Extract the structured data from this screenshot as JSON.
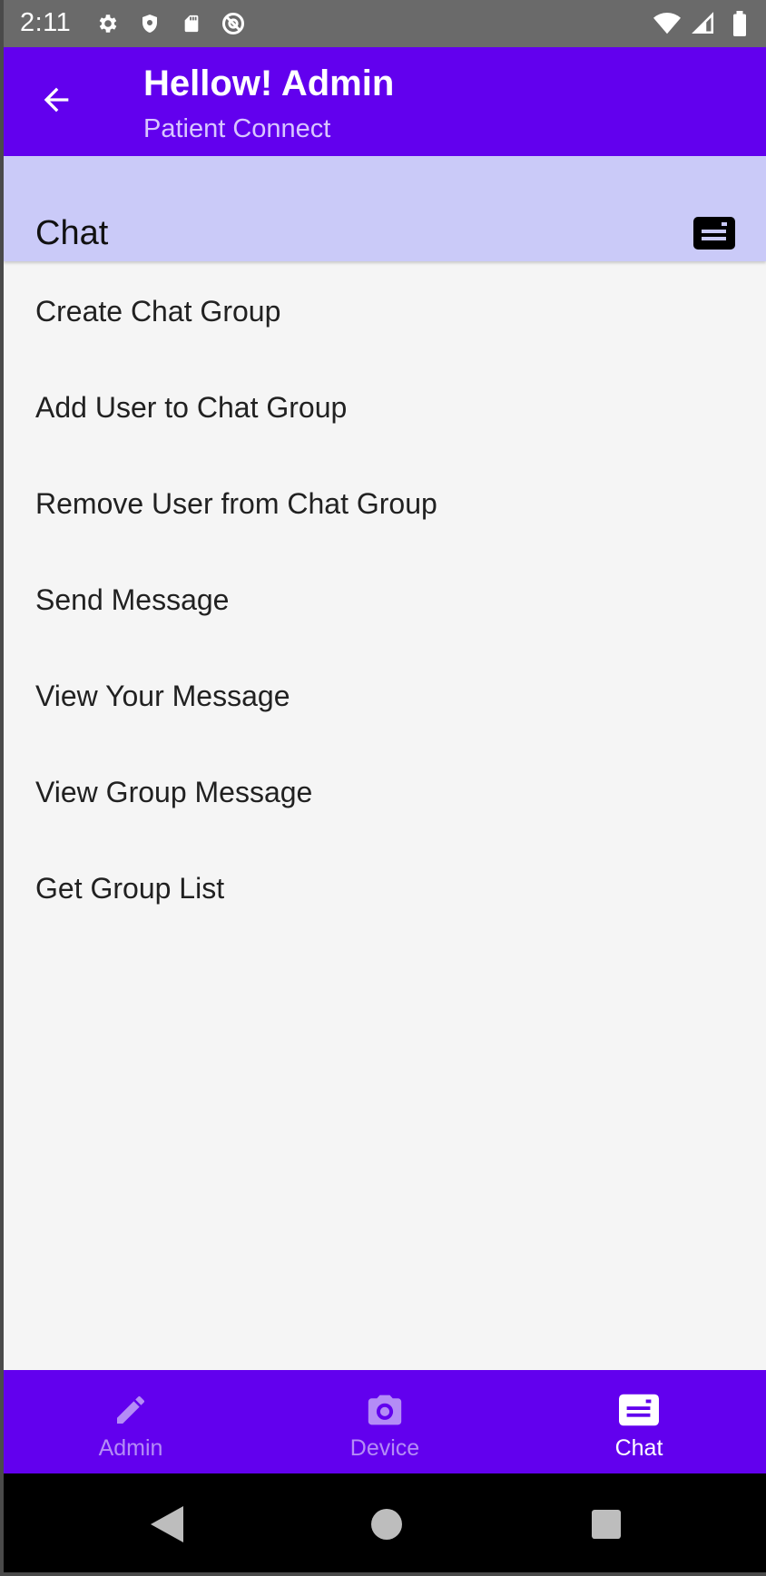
{
  "status_bar": {
    "time": "2:11",
    "left_icons": [
      "gear-icon",
      "shield-icon",
      "sd-card-icon",
      "at-sign-icon"
    ],
    "right_icons": [
      "wifi-icon",
      "cell-signal-icon",
      "battery-icon"
    ]
  },
  "app_bar": {
    "title": "Hellow! Admin",
    "subtitle": "Patient Connect",
    "back_icon": "arrow-back-icon"
  },
  "section": {
    "title": "Chat",
    "icon": "chat-card-icon"
  },
  "menu": {
    "items": [
      {
        "label": "Create Chat Group"
      },
      {
        "label": "Add User to Chat Group"
      },
      {
        "label": "Remove User from Chat Group"
      },
      {
        "label": "Send Message"
      },
      {
        "label": "View Your Message"
      },
      {
        "label": "View Group Message"
      },
      {
        "label": "Get Group List"
      }
    ]
  },
  "bottom_nav": {
    "tabs": [
      {
        "label": "Admin",
        "icon": "pencil-icon",
        "active": false
      },
      {
        "label": "Device",
        "icon": "camera-icon",
        "active": false
      },
      {
        "label": "Chat",
        "icon": "chat-card-icon",
        "active": true
      }
    ]
  },
  "colors": {
    "primary": "#6200ee",
    "section_header": "#cacaf8",
    "background": "#f5f5f5",
    "inactive_tab": "#b48cf6",
    "status_bar": "#6a6a6a"
  }
}
